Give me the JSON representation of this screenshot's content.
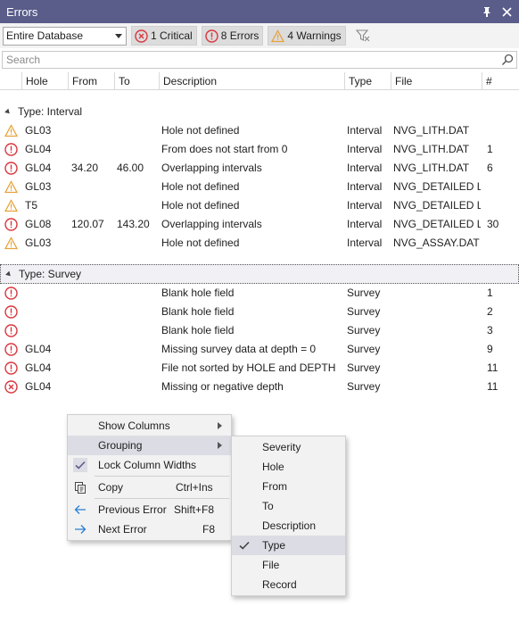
{
  "window": {
    "title": "Errors"
  },
  "toolbar": {
    "database_select": "Entire Database",
    "critical_label": "1 Critical",
    "errors_label": "8 Errors",
    "warnings_label": "4 Warnings"
  },
  "search": {
    "placeholder": "Search"
  },
  "columns": [
    "Hole",
    "From",
    "To",
    "Description",
    "Type",
    "File",
    "#"
  ],
  "groups": [
    {
      "label": "Type: Interval",
      "rows": [
        {
          "severity": "warning",
          "hole": "GL03",
          "from": "",
          "to": "",
          "description": "Hole not defined",
          "type": "Interval",
          "file": "NVG_LITH.DAT",
          "num": ""
        },
        {
          "severity": "error",
          "hole": "GL04",
          "from": "",
          "to": "",
          "description": "From does not start from 0",
          "type": "Interval",
          "file": "NVG_LITH.DAT",
          "num": "1"
        },
        {
          "severity": "error",
          "hole": "GL04",
          "from": "34.20",
          "to": "46.00",
          "description": "Overlapping intervals",
          "type": "Interval",
          "file": "NVG_LITH.DAT",
          "num": "6"
        },
        {
          "severity": "warning",
          "hole": "GL03",
          "from": "",
          "to": "",
          "description": "Hole not defined",
          "type": "Interval",
          "file": "NVG_DETAILED LI...",
          "num": ""
        },
        {
          "severity": "warning",
          "hole": "T5",
          "from": "",
          "to": "",
          "description": "Hole not defined",
          "type": "Interval",
          "file": "NVG_DETAILED LI...",
          "num": ""
        },
        {
          "severity": "error",
          "hole": "GL08",
          "from": "120.07",
          "to": "143.20",
          "description": "Overlapping intervals",
          "type": "Interval",
          "file": "NVG_DETAILED LI...",
          "num": "30"
        },
        {
          "severity": "warning",
          "hole": "GL03",
          "from": "",
          "to": "",
          "description": "Hole not defined",
          "type": "Interval",
          "file": "NVG_ASSAY.DAT",
          "num": ""
        }
      ]
    },
    {
      "label": "Type: Survey",
      "rows": [
        {
          "severity": "error",
          "hole": "",
          "from": "",
          "to": "",
          "description": "Blank hole field",
          "type": "Survey",
          "file": "",
          "num": "1"
        },
        {
          "severity": "error",
          "hole": "",
          "from": "",
          "to": "",
          "description": "Blank hole field",
          "type": "Survey",
          "file": "",
          "num": "2"
        },
        {
          "severity": "error",
          "hole": "",
          "from": "",
          "to": "",
          "description": "Blank hole field",
          "type": "Survey",
          "file": "",
          "num": "3"
        },
        {
          "severity": "error",
          "hole": "GL04",
          "from": "",
          "to": "",
          "description": "Missing survey data at depth = 0",
          "type": "Survey",
          "file": "",
          "num": "9"
        },
        {
          "severity": "error",
          "hole": "GL04",
          "from": "",
          "to": "",
          "description": "File not sorted by HOLE and DEPTH",
          "type": "Survey",
          "file": "",
          "num": "11"
        },
        {
          "severity": "critical",
          "hole": "GL04",
          "from": "",
          "to": "",
          "description": "Missing or negative depth",
          "type": "Survey",
          "file": "",
          "num": "11"
        }
      ]
    }
  ],
  "context_menu": {
    "items": [
      {
        "label": "Show Columns",
        "shortcut": "",
        "icon": "",
        "submenu": true
      },
      {
        "label": "Grouping",
        "shortcut": "",
        "icon": "",
        "submenu": true
      },
      {
        "label": "Lock Column Widths",
        "shortcut": "",
        "icon": "checkmark-icon",
        "submenu": false
      },
      {
        "label": "Copy",
        "shortcut": "Ctrl+Ins",
        "icon": "copy-icon",
        "submenu": false
      },
      {
        "label": "Previous Error",
        "shortcut": "Shift+F8",
        "icon": "arrow-left-icon",
        "submenu": false
      },
      {
        "label": "Next Error",
        "shortcut": "F8",
        "icon": "arrow-right-icon",
        "submenu": false
      }
    ]
  },
  "grouping_submenu": {
    "items": [
      "Severity",
      "Hole",
      "From",
      "To",
      "Description",
      "Type",
      "File",
      "Record"
    ],
    "checked": "Type"
  },
  "colors": {
    "titlebar": "#5a5d8a",
    "error": "#d9363e",
    "warning": "#e8a23a",
    "highlight": "#dcdce4"
  }
}
